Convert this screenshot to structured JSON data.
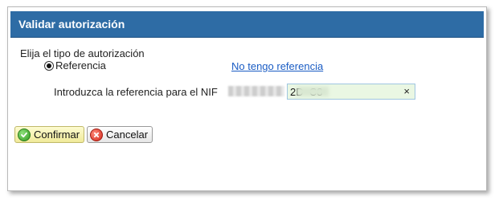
{
  "dialog": {
    "title": "Validar autorización"
  },
  "form": {
    "prompt": "Elija el tipo de autorización",
    "radio_label": "Referencia",
    "link_text": "No tengo referencia",
    "nif_label": "Introduzca la referencia para el NIF",
    "reference_value": "2D  C8",
    "clear_symbol": "×"
  },
  "buttons": {
    "confirm_label": "Confirmar",
    "cancel_label": "Cancelar"
  },
  "icons": {
    "confirm": "check-icon",
    "cancel": "cancel-icon"
  },
  "colors": {
    "header": "#2e6ca5",
    "link": "#1a5cc4",
    "input_bg": "#eaf7e3",
    "confirm_bg": "#f0ea9a"
  }
}
